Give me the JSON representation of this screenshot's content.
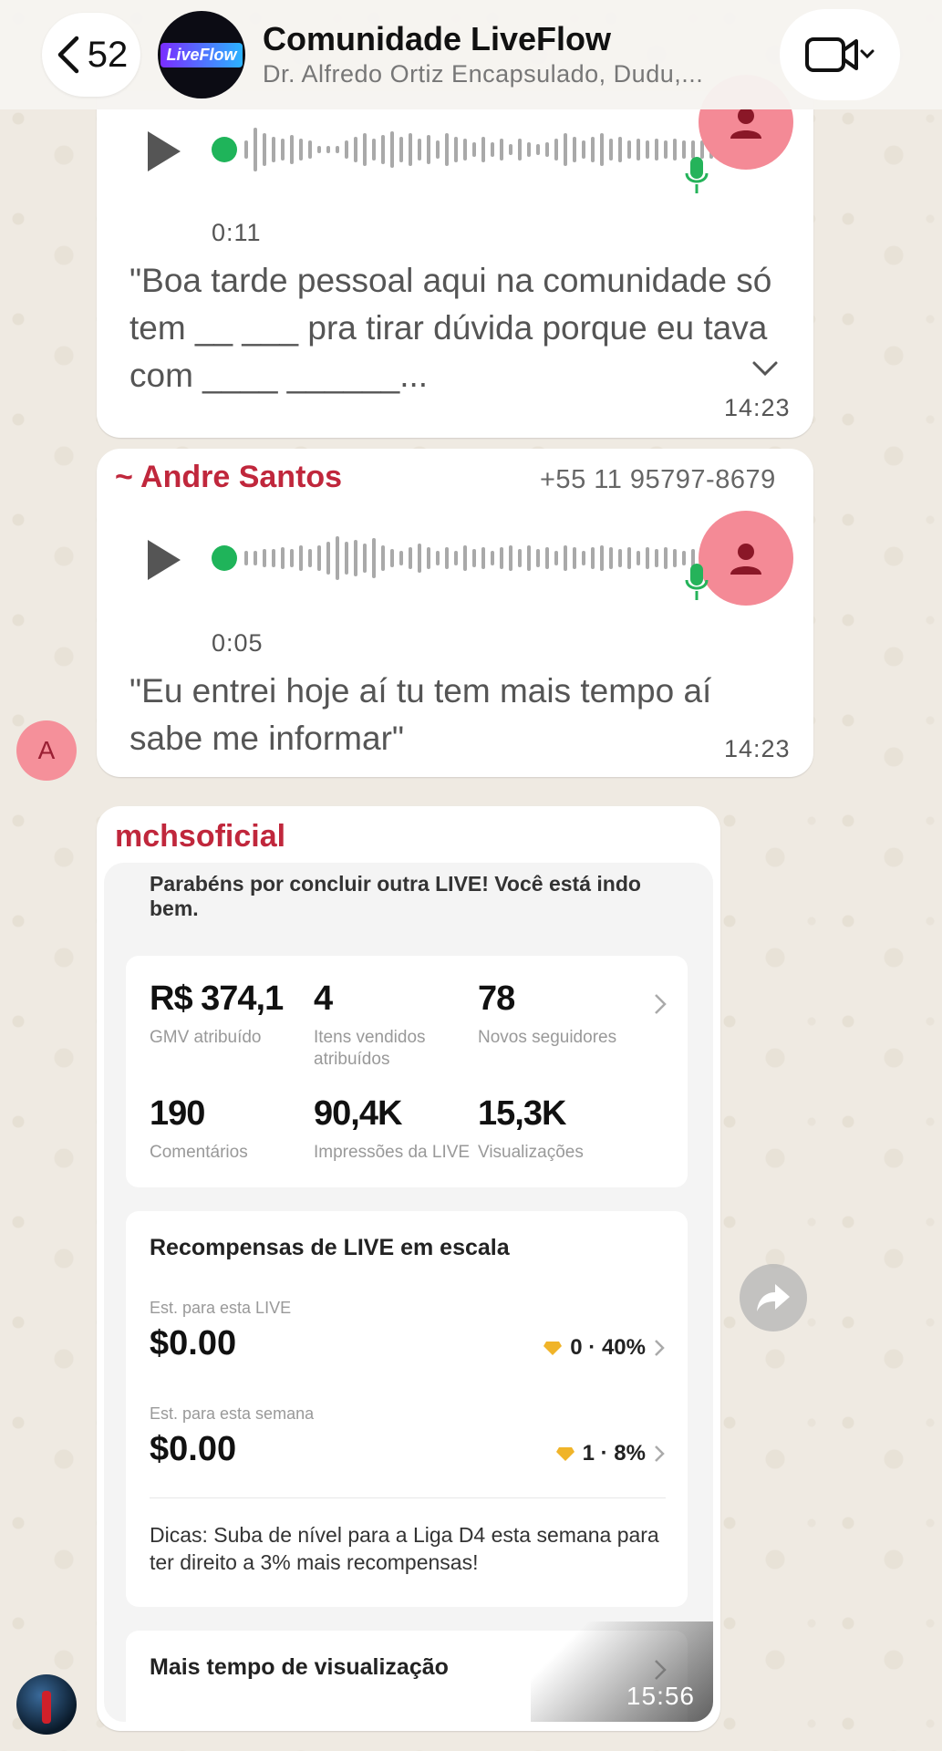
{
  "header": {
    "back_count": "52",
    "title": "Comunidade LiveFlow",
    "subtitle": "Dr. Alfredo Ortiz Encapsulado, Dudu,...",
    "logo_text": "LiveFlow"
  },
  "messages": [
    {
      "duration": "0:11",
      "transcript": "\"Boa tarde pessoal aqui na comunidade só tem __ ___ pra tirar dúvida porque eu tava com ____ ______...",
      "time": "14:23"
    },
    {
      "sender": "~ Andre Santos",
      "phone": "+55 11 95797-8679",
      "duration": "0:05",
      "transcript": "\"Eu entrei hoje aí tu tem mais tempo aí sabe me informar\"",
      "time": "14:23",
      "avatar_letter": "A"
    },
    {
      "sender": "mchsoficial",
      "time": "15:56"
    }
  ],
  "screenshot": {
    "congrats": "Parabéns por concluir outra LIVE! Você está indo bem.",
    "metrics": [
      {
        "value": "R$ 374,1",
        "label": "GMV atribuído"
      },
      {
        "value": "4",
        "label": "Itens vendidos atribuídos"
      },
      {
        "value": "78",
        "label": "Novos seguidores"
      },
      {
        "value": "190",
        "label": "Comentários"
      },
      {
        "value": "90,4K",
        "label": "Impressões da LIVE"
      },
      {
        "value": "15,3K",
        "label": "Visualizações"
      }
    ],
    "rewards_title": "Recompensas de LIVE em escala",
    "est_live_label": "Est. para esta LIVE",
    "est_live_value": "$0.00",
    "est_live_right": "0 · 40%",
    "est_week_label": "Est. para esta semana",
    "est_week_value": "$0.00",
    "est_week_right": "1 · 8%",
    "tips": "Dicas: Suba de nível para a Liga D4 esta semana para ter direito a 3% mais recompensas!",
    "more_time": "Mais tempo de visualização"
  },
  "colors": {
    "accent_name": "#c0273c",
    "voice_avatar": "#f48a96",
    "mic_green": "#25b35a",
    "play_dot": "#1fb45a"
  }
}
